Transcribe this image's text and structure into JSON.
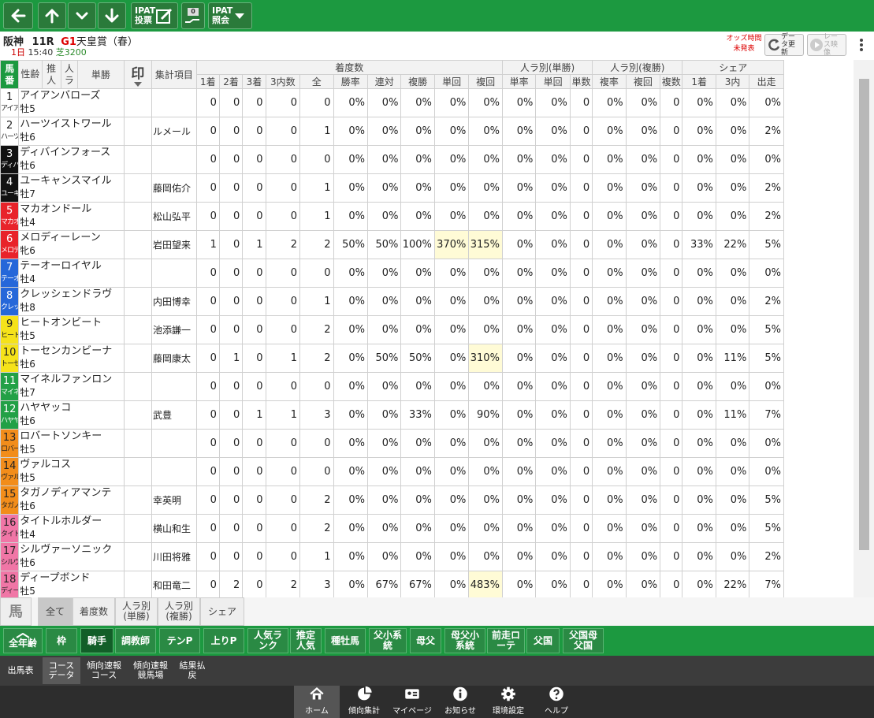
{
  "toolbar": {
    "ipat_vote": "IPAT投票",
    "ipat_inquiry": "IPAT照会",
    "badge": "0"
  },
  "race": {
    "venue": "阪神",
    "race_no": "11R",
    "grade": "G1",
    "name": "天皇賞（春）",
    "day": "1日",
    "time": "15:40",
    "course": "芝3200"
  },
  "header_buttons": {
    "odds_note": "オッズ時間未発表",
    "update": "データ更新",
    "video": "レース映像"
  },
  "columns": {
    "fixed": {
      "num": "馬番",
      "sex_age": "性齢",
      "suitei": "推人",
      "ninki": "人ラ",
      "tansho": "単勝",
      "mark": "印",
      "item": "集計項目"
    },
    "group_result": "着度数",
    "group_tan": "人ラ別(単勝)",
    "group_fuku": "人ラ別(複勝)",
    "group_share": "シェア",
    "sub": [
      "1着",
      "2着",
      "3着",
      "3内数",
      "全",
      "勝率",
      "連対",
      "複勝",
      "単回",
      "複回",
      "単率",
      "単回",
      "単数",
      "複率",
      "複回",
      "複数",
      "1着",
      "3内",
      "出走"
    ]
  },
  "horses": [
    {
      "num": "1",
      "abbr": "アイア",
      "name": "アイアンバローズ",
      "sa": "牡5",
      "jockey": "",
      "stats": [
        "0",
        "0",
        "0",
        "0",
        "0",
        "0%",
        "0%",
        "0%",
        "0%",
        "0%",
        "0%",
        "0%",
        "0",
        "0%",
        "0%",
        "0",
        "0%",
        "0%",
        "0%"
      ]
    },
    {
      "num": "2",
      "abbr": "ハーツ",
      "name": "ハーツイストワール",
      "sa": "牡6",
      "jockey": "ルメール",
      "stats": [
        "0",
        "0",
        "0",
        "0",
        "1",
        "0%",
        "0%",
        "0%",
        "0%",
        "0%",
        "0%",
        "0%",
        "0",
        "0%",
        "0%",
        "0",
        "0%",
        "0%",
        "2%"
      ]
    },
    {
      "num": "3",
      "abbr": "ディバ",
      "name": "ディバインフォース",
      "sa": "牡6",
      "jockey": "",
      "stats": [
        "0",
        "0",
        "0",
        "0",
        "0",
        "0%",
        "0%",
        "0%",
        "0%",
        "0%",
        "0%",
        "0%",
        "0",
        "0%",
        "0%",
        "0",
        "0%",
        "0%",
        "0%"
      ]
    },
    {
      "num": "4",
      "abbr": "ユーキ",
      "name": "ユーキャンスマイル",
      "sa": "牡7",
      "jockey": "藤岡佑介",
      "stats": [
        "0",
        "0",
        "0",
        "0",
        "1",
        "0%",
        "0%",
        "0%",
        "0%",
        "0%",
        "0%",
        "0%",
        "0",
        "0%",
        "0%",
        "0",
        "0%",
        "0%",
        "2%"
      ]
    },
    {
      "num": "5",
      "abbr": "マカオ",
      "name": "マカオンドール",
      "sa": "牡4",
      "jockey": "松山弘平",
      "stats": [
        "0",
        "0",
        "0",
        "0",
        "1",
        "0%",
        "0%",
        "0%",
        "0%",
        "0%",
        "0%",
        "0%",
        "0",
        "0%",
        "0%",
        "0",
        "0%",
        "0%",
        "2%"
      ]
    },
    {
      "num": "6",
      "abbr": "メロデ",
      "name": "メロディーレーン",
      "sa": "牝6",
      "jockey": "岩田望来",
      "stats": [
        "1",
        "0",
        "1",
        "2",
        "2",
        "50%",
        "50%",
        "100%",
        "370%",
        "315%",
        "0%",
        "0%",
        "0",
        "0%",
        "0%",
        "0",
        "33%",
        "22%",
        "5%"
      ],
      "hl": [
        8,
        9
      ]
    },
    {
      "num": "7",
      "abbr": "テーオ",
      "name": "テーオーロイヤル",
      "sa": "牡4",
      "jockey": "",
      "stats": [
        "0",
        "0",
        "0",
        "0",
        "0",
        "0%",
        "0%",
        "0%",
        "0%",
        "0%",
        "0%",
        "0%",
        "0",
        "0%",
        "0%",
        "0",
        "0%",
        "0%",
        "0%"
      ]
    },
    {
      "num": "8",
      "abbr": "クレッ",
      "name": "クレッシェンドラヴ",
      "sa": "牡8",
      "jockey": "内田博幸",
      "stats": [
        "0",
        "0",
        "0",
        "0",
        "1",
        "0%",
        "0%",
        "0%",
        "0%",
        "0%",
        "0%",
        "0%",
        "0",
        "0%",
        "0%",
        "0",
        "0%",
        "0%",
        "2%"
      ]
    },
    {
      "num": "9",
      "abbr": "ヒート",
      "name": "ヒートオンビート",
      "sa": "牡5",
      "jockey": "池添謙一",
      "stats": [
        "0",
        "0",
        "0",
        "0",
        "2",
        "0%",
        "0%",
        "0%",
        "0%",
        "0%",
        "0%",
        "0%",
        "0",
        "0%",
        "0%",
        "0",
        "0%",
        "0%",
        "5%"
      ]
    },
    {
      "num": "10",
      "abbr": "トーセ",
      "name": "トーセンカンビーナ",
      "sa": "牡6",
      "jockey": "藤岡康太",
      "stats": [
        "0",
        "1",
        "0",
        "1",
        "2",
        "0%",
        "50%",
        "50%",
        "0%",
        "310%",
        "0%",
        "0%",
        "0",
        "0%",
        "0%",
        "0",
        "0%",
        "11%",
        "5%"
      ],
      "hl": [
        9
      ]
    },
    {
      "num": "11",
      "abbr": "マイネ",
      "name": "マイネルファンロン",
      "sa": "牡7",
      "jockey": "",
      "stats": [
        "0",
        "0",
        "0",
        "0",
        "0",
        "0%",
        "0%",
        "0%",
        "0%",
        "0%",
        "0%",
        "0%",
        "0",
        "0%",
        "0%",
        "0",
        "0%",
        "0%",
        "0%"
      ]
    },
    {
      "num": "12",
      "abbr": "ハヤヤ",
      "name": "ハヤヤッコ",
      "sa": "牡6",
      "jockey": "武豊",
      "stats": [
        "0",
        "0",
        "1",
        "1",
        "3",
        "0%",
        "0%",
        "33%",
        "0%",
        "90%",
        "0%",
        "0%",
        "0",
        "0%",
        "0%",
        "0",
        "0%",
        "11%",
        "7%"
      ]
    },
    {
      "num": "13",
      "abbr": "ロバー",
      "name": "ロバートソンキー",
      "sa": "牡5",
      "jockey": "",
      "stats": [
        "0",
        "0",
        "0",
        "0",
        "0",
        "0%",
        "0%",
        "0%",
        "0%",
        "0%",
        "0%",
        "0%",
        "0",
        "0%",
        "0%",
        "0",
        "0%",
        "0%",
        "0%"
      ]
    },
    {
      "num": "14",
      "abbr": "ヴァル",
      "name": "ヴァルコス",
      "sa": "牡5",
      "jockey": "",
      "stats": [
        "0",
        "0",
        "0",
        "0",
        "0",
        "0%",
        "0%",
        "0%",
        "0%",
        "0%",
        "0%",
        "0%",
        "0",
        "0%",
        "0%",
        "0",
        "0%",
        "0%",
        "0%"
      ]
    },
    {
      "num": "15",
      "abbr": "タガノ",
      "name": "タガノディアマンテ",
      "sa": "牡6",
      "jockey": "幸英明",
      "stats": [
        "0",
        "0",
        "0",
        "0",
        "2",
        "0%",
        "0%",
        "0%",
        "0%",
        "0%",
        "0%",
        "0%",
        "0",
        "0%",
        "0%",
        "0",
        "0%",
        "0%",
        "5%"
      ]
    },
    {
      "num": "16",
      "abbr": "タイト",
      "name": "タイトルホルダー",
      "sa": "牡4",
      "jockey": "横山和生",
      "stats": [
        "0",
        "0",
        "0",
        "0",
        "2",
        "0%",
        "0%",
        "0%",
        "0%",
        "0%",
        "0%",
        "0%",
        "0",
        "0%",
        "0%",
        "0",
        "0%",
        "0%",
        "5%"
      ]
    },
    {
      "num": "17",
      "abbr": "シルヴ",
      "name": "シルヴァーソニック",
      "sa": "牡6",
      "jockey": "川田将雅",
      "stats": [
        "0",
        "0",
        "0",
        "0",
        "1",
        "0%",
        "0%",
        "0%",
        "0%",
        "0%",
        "0%",
        "0%",
        "0",
        "0%",
        "0%",
        "0",
        "0%",
        "0%",
        "2%"
      ]
    },
    {
      "num": "18",
      "abbr": "ディー",
      "name": "ディープボンド",
      "sa": "牡5",
      "jockey": "和田竜二",
      "stats": [
        "0",
        "2",
        "0",
        "2",
        "3",
        "0%",
        "67%",
        "67%",
        "0%",
        "483%",
        "0%",
        "0%",
        "0",
        "0%",
        "0%",
        "0",
        "0%",
        "22%",
        "7%"
      ],
      "hl": [
        9
      ]
    }
  ],
  "frame_colors": [
    "#ffffff",
    "#ffffff",
    "#111111",
    "#111111",
    "#e8232a",
    "#e8232a",
    "#2567d9",
    "#2567d9",
    "#f5e21a",
    "#f5e21a",
    "#22a046",
    "#22a046",
    "#f28d1b",
    "#f28d1b",
    "#f28d1b",
    "#f076a6",
    "#f076a6",
    "#f076a6"
  ],
  "frame_text_colors": [
    "#222",
    "#222",
    "#fff",
    "#fff",
    "#fff",
    "#fff",
    "#fff",
    "#fff",
    "#222",
    "#222",
    "#fff",
    "#fff",
    "#222",
    "#222",
    "#222",
    "#222",
    "#222",
    "#222"
  ],
  "tabs_view": {
    "horse": "馬",
    "all": "全て",
    "result": "着度数",
    "tan": "人ラ別(単勝)",
    "fuku": "人ラ別(複勝)",
    "share": "シェア"
  },
  "nav_green": [
    {
      "label": "全年齢",
      "name": "nav-all-ages"
    },
    {
      "label": "枠",
      "name": "nav-frame"
    },
    {
      "label": "騎手",
      "name": "nav-jockey",
      "active": true
    },
    {
      "label": "調教師",
      "name": "nav-trainer"
    },
    {
      "label": "テンP",
      "name": "nav-ten-p"
    },
    {
      "label": "上りP",
      "name": "nav-agari-p"
    },
    {
      "label": "人気ランク",
      "name": "nav-popularity-rank"
    },
    {
      "label": "推定人気",
      "name": "nav-estimated-popularity"
    },
    {
      "label": "種牡馬",
      "name": "nav-sire"
    },
    {
      "label": "父小系統",
      "name": "nav-sire-line"
    },
    {
      "label": "母父",
      "name": "nav-dam-sire"
    },
    {
      "label": "母父小系統",
      "name": "nav-dam-sire-line"
    },
    {
      "label": "前走ローテ",
      "name": "nav-prev-rotation"
    },
    {
      "label": "父国",
      "name": "nav-sire-country"
    },
    {
      "label": "父国母父国",
      "name": "nav-sire-dam-country"
    }
  ],
  "nav_dark": [
    {
      "label": "出馬表",
      "name": "nav-entry-table"
    },
    {
      "label": "コースデータ",
      "name": "nav-course-data",
      "active": true
    },
    {
      "label": "傾向速報コース",
      "name": "nav-trend-course"
    },
    {
      "label": "傾向速報競馬場",
      "name": "nav-trend-track"
    },
    {
      "label": "結果払戻",
      "name": "nav-results"
    }
  ],
  "bottom_nav": [
    {
      "label": "ホーム",
      "name": "bottom-home",
      "icon": "home-icon",
      "active": true
    },
    {
      "label": "傾向集計",
      "name": "bottom-trend",
      "icon": "pie-chart-icon"
    },
    {
      "label": "マイページ",
      "name": "bottom-mypage",
      "icon": "id-card-icon"
    },
    {
      "label": "お知らせ",
      "name": "bottom-news",
      "icon": "info-icon"
    },
    {
      "label": "環境設定",
      "name": "bottom-settings",
      "icon": "gear-icon"
    },
    {
      "label": "ヘルプ",
      "name": "bottom-help",
      "icon": "help-icon"
    }
  ]
}
